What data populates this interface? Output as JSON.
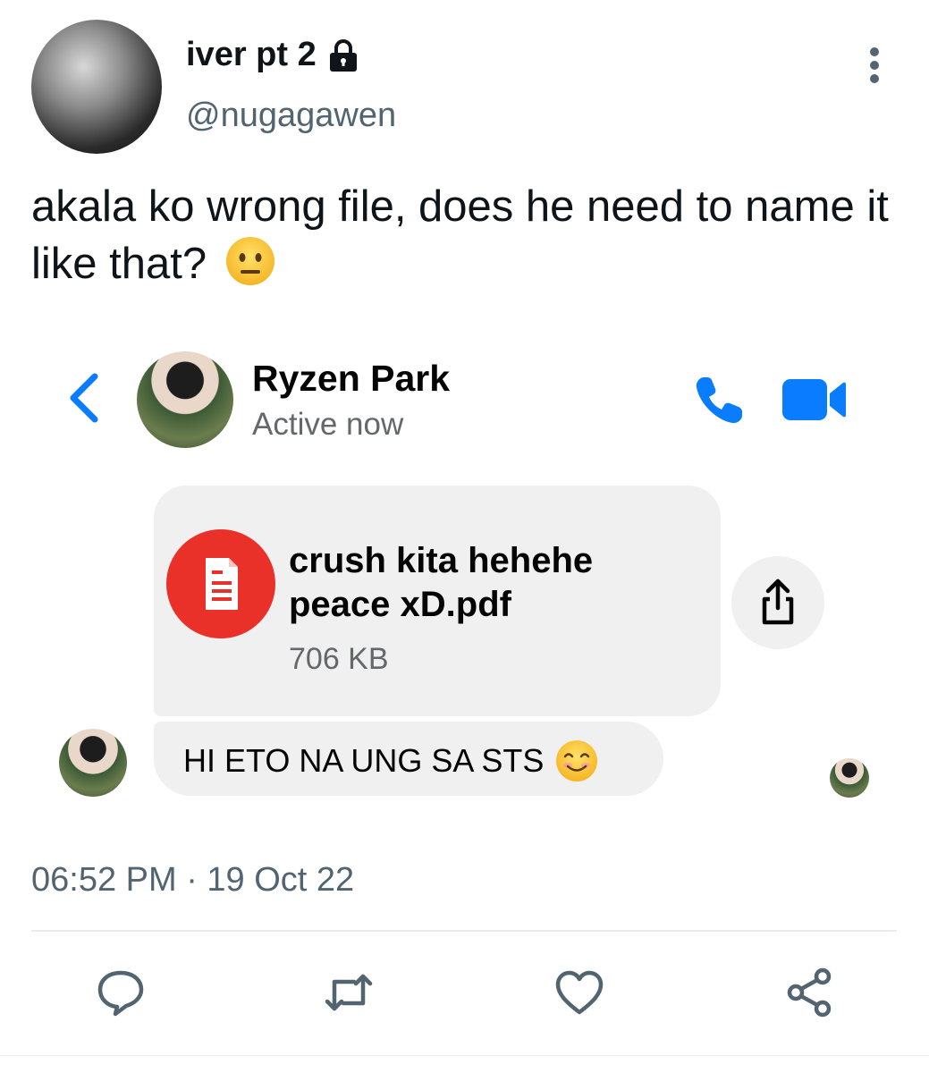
{
  "tweet": {
    "display_name": "iver pt 2",
    "handle": "@nugagawen",
    "text": "akala ko wrong file, does he need to name it like that?",
    "timestamp": "06:52 PM · 19 Oct 22"
  },
  "messenger": {
    "contact_name": "Ryzen Park",
    "status": "Active now",
    "file": {
      "name": "crush kita hehehe peace xD.pdf",
      "size": "706 KB"
    },
    "message": "HI ETO NA UNG SA STS"
  },
  "icons": {
    "lock": "lock-icon",
    "more": "more-vertical-icon",
    "back": "chevron-left-icon",
    "phone": "phone-icon",
    "video": "video-camera-icon",
    "file": "pdf-file-icon",
    "share_file": "share-upload-icon",
    "reply": "reply-icon",
    "retweet": "retweet-icon",
    "like": "heart-icon",
    "share": "share-icon"
  },
  "colors": {
    "messenger_blue": "#0a7cff",
    "pdf_red": "#e9312a",
    "secondary_text": "#536471",
    "bubble_gray": "#f0f0f0"
  }
}
